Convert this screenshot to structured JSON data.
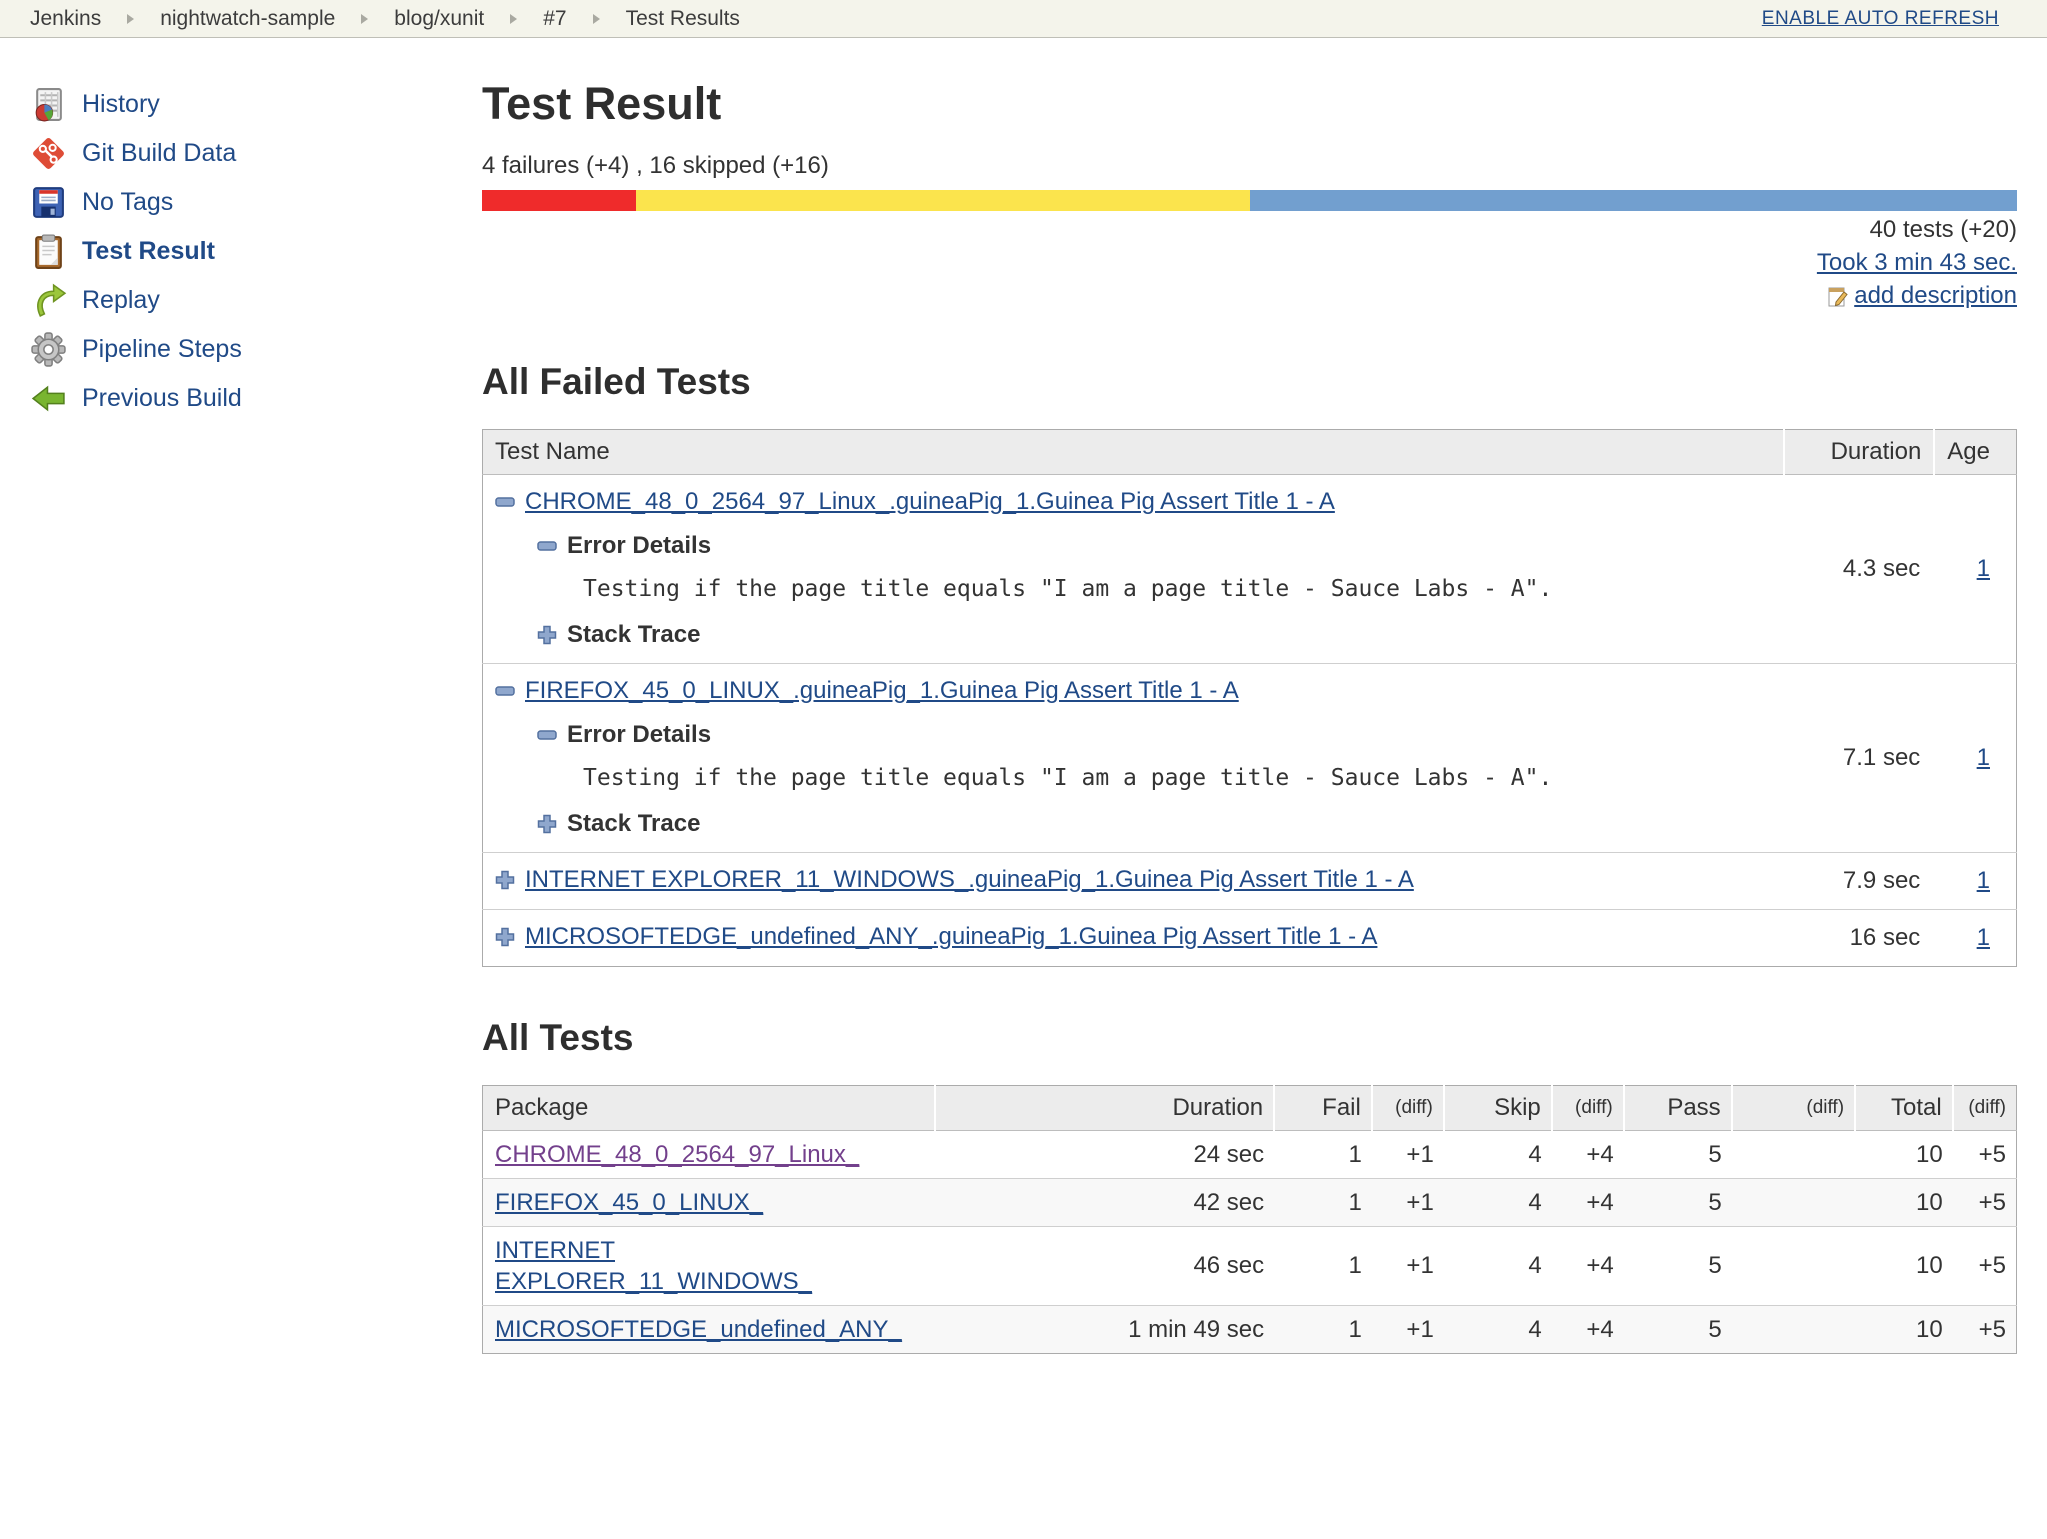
{
  "colors": {
    "link": "#204A87",
    "visited_link": "#73408C",
    "fail_red": "#EF2B2B",
    "skip_yellow": "#FBE44D",
    "pass_blue": "#729FCF",
    "breadcrumb_bg": "#F4F4EB"
  },
  "breadcrumb": {
    "items": [
      "Jenkins",
      "nightwatch-sample",
      "blog/xunit",
      "#7",
      "Test Results"
    ],
    "auto_refresh_label": "ENABLE AUTO REFRESH"
  },
  "sidebar": {
    "items": [
      {
        "label": "History",
        "icon": "history-icon",
        "current": false
      },
      {
        "label": "Git Build Data",
        "icon": "git-icon",
        "current": false
      },
      {
        "label": "No Tags",
        "icon": "floppy-icon",
        "current": false
      },
      {
        "label": "Test Result",
        "icon": "clipboard-icon",
        "current": true
      },
      {
        "label": "Replay",
        "icon": "replay-icon",
        "current": false
      },
      {
        "label": "Pipeline Steps",
        "icon": "gear-icon",
        "current": false
      },
      {
        "label": "Previous Build",
        "icon": "previous-build-icon",
        "current": false
      }
    ]
  },
  "main": {
    "title": "Test Result",
    "summary": "4 failures (+4) , 16 skipped (+16)",
    "tests_count": "40 tests (+20)",
    "took_label": "Took 3 min 43 sec.",
    "add_description_label": "add description",
    "progress": {
      "failed_pct": 10,
      "skipped_pct": 40,
      "passed_pct": 50
    }
  },
  "failed_tests": {
    "heading": "All Failed Tests",
    "columns": {
      "name": "Test Name",
      "duration": "Duration",
      "age": "Age"
    },
    "rows": [
      {
        "name": "CHROME_48_0_2564_97_Linux_.guineaPig_1.Guinea Pig Assert Title 1 - A",
        "expanded": true,
        "error_details_label": "Error Details",
        "error_text": "Testing if the page title equals \"I am a page title - Sauce Labs - A\".",
        "stack_trace_label": "Stack Trace",
        "duration": "4.3 sec",
        "age": "1"
      },
      {
        "name": "FIREFOX_45_0_LINUX_.guineaPig_1.Guinea Pig Assert Title 1 - A",
        "expanded": true,
        "error_details_label": "Error Details",
        "error_text": "Testing if the page title equals \"I am a page title - Sauce Labs - A\".",
        "stack_trace_label": "Stack Trace",
        "duration": "7.1 sec",
        "age": "1"
      },
      {
        "name": "INTERNET EXPLORER_11_WINDOWS_.guineaPig_1.Guinea Pig Assert Title 1 - A",
        "expanded": false,
        "duration": "7.9 sec",
        "age": "1"
      },
      {
        "name": "MICROSOFTEDGE_undefined_ANY_.guineaPig_1.Guinea Pig Assert Title 1 - A",
        "expanded": false,
        "duration": "16 sec",
        "age": "1"
      }
    ]
  },
  "all_tests": {
    "heading": "All Tests",
    "columns": [
      "Package",
      "Duration",
      "Fail",
      "(diff)",
      "Skip",
      "(diff)",
      "Pass",
      "(diff)",
      "Total",
      "(diff)"
    ],
    "rows": [
      {
        "package": "CHROME_48_0_2564_97_Linux_",
        "visited": true,
        "duration": "24 sec",
        "fail": "1",
        "fail_diff": "+1",
        "skip": "4",
        "skip_diff": "+4",
        "pass": "5",
        "pass_diff": "",
        "total": "10",
        "total_diff": "+5"
      },
      {
        "package": "FIREFOX_45_0_LINUX_",
        "visited": false,
        "duration": "42 sec",
        "fail": "1",
        "fail_diff": "+1",
        "skip": "4",
        "skip_diff": "+4",
        "pass": "5",
        "pass_diff": "",
        "total": "10",
        "total_diff": "+5"
      },
      {
        "package": "INTERNET EXPLORER_11_WINDOWS_",
        "visited": false,
        "duration": "46 sec",
        "fail": "1",
        "fail_diff": "+1",
        "skip": "4",
        "skip_diff": "+4",
        "pass": "5",
        "pass_diff": "",
        "total": "10",
        "total_diff": "+5"
      },
      {
        "package": "MICROSOFTEDGE_undefined_ANY_",
        "visited": false,
        "duration": "1 min 49 sec",
        "fail": "1",
        "fail_diff": "+1",
        "skip": "4",
        "skip_diff": "+4",
        "pass": "5",
        "pass_diff": "",
        "total": "10",
        "total_diff": "+5"
      }
    ]
  }
}
